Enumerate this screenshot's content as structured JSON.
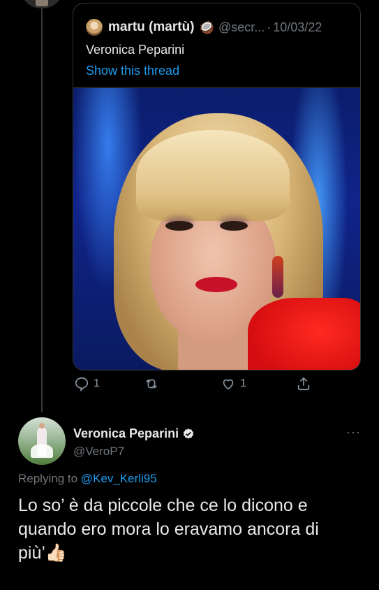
{
  "quoted_tweet": {
    "author_name": "martu (martù)",
    "author_emoji": "🥥",
    "author_handle": "@secr...",
    "separator": "·",
    "date": "10/03/22",
    "text": "Veronica Peparini",
    "thread_link": "Show this thread",
    "actions": {
      "reply_count": "1",
      "retweet_count": "",
      "like_count": "1"
    }
  },
  "reply_tweet": {
    "author_name": "Veronica Peparini",
    "author_handle": "@VeroP7",
    "more_label": "···",
    "replying_prefix": "Replying to",
    "replying_handle": "@Kev_Kerli95",
    "text": "Lo so’ è da piccole che ce lo dicono e quando ero mora lo eravamo ancora di più’👍🏻"
  },
  "colors": {
    "background": "#000000",
    "text": "#e7e9ea",
    "muted": "#71767b",
    "link": "#1d9bf0",
    "verified": "#e7e9ea"
  }
}
